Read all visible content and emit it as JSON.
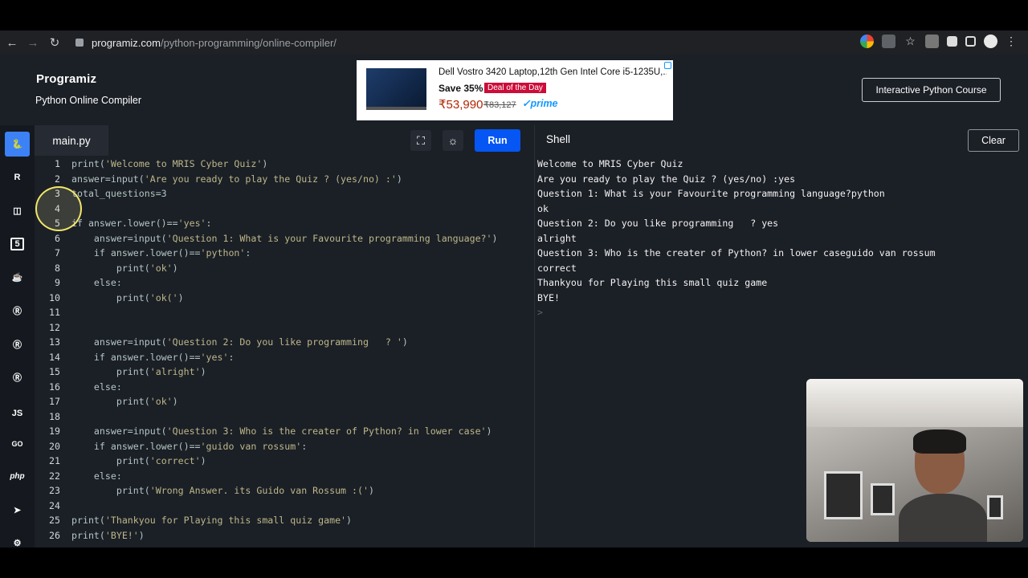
{
  "browser": {
    "url_host": "programiz.com",
    "url_path": "/python-programming/online-compiler/"
  },
  "site": {
    "logo": "Programiz",
    "subtitle": "Python Online Compiler",
    "course_button": "Interactive Python Course"
  },
  "ad": {
    "title": "Dell Vostro 3420 Laptop,12th Gen Intel Core i5-1235U,...",
    "save": "Save 35%",
    "deal": "Deal of the Day",
    "price": "₹53,990",
    "old_price": "₹83,127",
    "prime": "✓prime"
  },
  "rail": {
    "items": [
      "python-icon",
      "r-icon",
      "sql-icon",
      "html-icon",
      "java-icon",
      "c-icon",
      "cpp-icon",
      "csharp-icon",
      "js-icon",
      "go-icon",
      "php-icon",
      "swift-icon",
      "rust-icon"
    ],
    "labels": {
      "js": "JS",
      "go": "GO",
      "php": "php",
      "html": "5"
    }
  },
  "editor": {
    "tab": "main.py",
    "run_label": "Run",
    "lines": [
      {
        "n": "1",
        "code": "print('Welcome to MRIS Cyber Quiz')"
      },
      {
        "n": "2",
        "code": "answer=input('Are you ready to play the Quiz ? (yes/no) :')"
      },
      {
        "n": "3",
        "code": "total_questions=3"
      },
      {
        "n": "4",
        "code": ""
      },
      {
        "n": "5",
        "code": "if answer.lower()=='yes':"
      },
      {
        "n": "6",
        "code": "    answer=input('Question 1: What is your Favourite programming language?')"
      },
      {
        "n": "7",
        "code": "    if answer.lower()=='python':"
      },
      {
        "n": "8",
        "code": "        print('ok')"
      },
      {
        "n": "9",
        "code": "    else:"
      },
      {
        "n": "10",
        "code": "        print('ok(')"
      },
      {
        "n": "11",
        "code": ""
      },
      {
        "n": "12",
        "code": ""
      },
      {
        "n": "13",
        "code": "    answer=input('Question 2: Do you like programming   ? ')"
      },
      {
        "n": "14",
        "code": "    if answer.lower()=='yes':"
      },
      {
        "n": "15",
        "code": "        print('alright')"
      },
      {
        "n": "16",
        "code": "    else:"
      },
      {
        "n": "17",
        "code": "        print('ok')"
      },
      {
        "n": "18",
        "code": ""
      },
      {
        "n": "19",
        "code": "    answer=input('Question 3: Who is the creater of Python? in lower case')"
      },
      {
        "n": "20",
        "code": "    if answer.lower()=='guido van rossum':"
      },
      {
        "n": "21",
        "code": "        print('correct')"
      },
      {
        "n": "22",
        "code": "    else:"
      },
      {
        "n": "23",
        "code": "        print('Wrong Answer. its Guido van Rossum :(')"
      },
      {
        "n": "24",
        "code": ""
      },
      {
        "n": "25",
        "code": "print('Thankyou for Playing this small quiz game')"
      },
      {
        "n": "26",
        "code": "print('BYE!')"
      }
    ]
  },
  "shell": {
    "title": "Shell",
    "clear_label": "Clear",
    "output": [
      "Welcome to MRIS Cyber Quiz",
      "Are you ready to play the Quiz ? (yes/no) :yes",
      "Question 1: What is your Favourite programming language?python",
      "ok",
      "Question 2: Do you like programming   ? yes",
      "alright",
      "Question 3: Who is the creater of Python? in lower caseguido van rossum",
      "correct",
      "Thankyou for Playing this small quiz game",
      "BYE!"
    ],
    "prompt": ">"
  }
}
